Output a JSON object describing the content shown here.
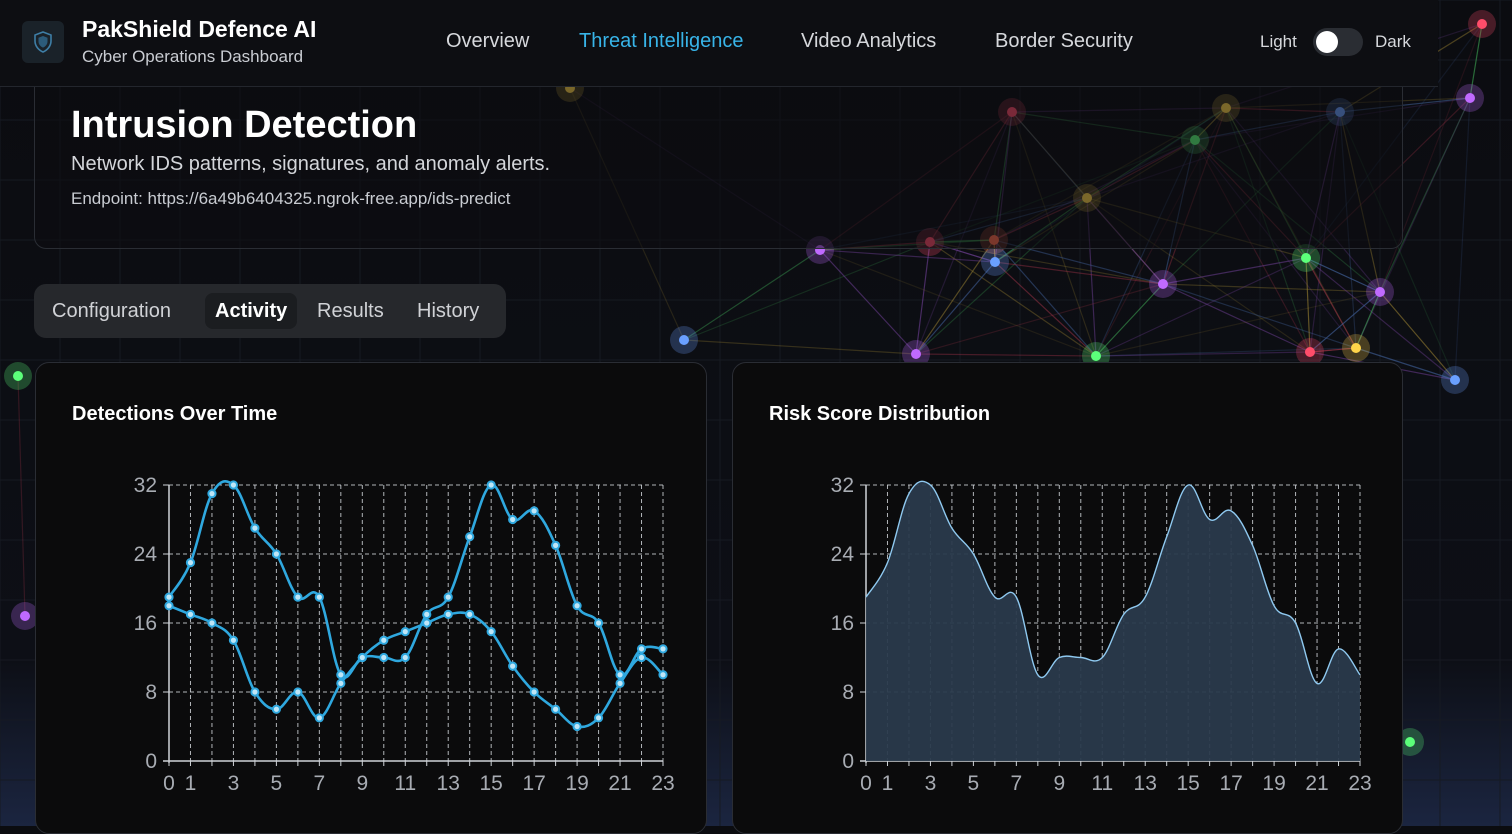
{
  "header": {
    "app_title": "PakShield Defence AI",
    "app_subtitle": "Cyber Operations Dashboard",
    "logo_icon": "shield-icon",
    "nav": [
      {
        "label": "Overview",
        "active": false
      },
      {
        "label": "Threat Intelligence",
        "active": true
      },
      {
        "label": "Video Analytics",
        "active": false
      },
      {
        "label": "Border Security",
        "active": false
      }
    ],
    "theme_toggle": {
      "light_label": "Light",
      "dark_label": "Dark",
      "state": "light"
    },
    "accent_color": "#38b4e8"
  },
  "page": {
    "title": "Intrusion Detection",
    "description": "Network IDS patterns, signatures, and anomaly alerts.",
    "endpoint": "Endpoint: https://6a49b6404325.ngrok-free.app/ids-predict"
  },
  "tabs": [
    {
      "label": "Configuration",
      "active": false
    },
    {
      "label": "Activity",
      "active": true
    },
    {
      "label": "Results",
      "active": false
    },
    {
      "label": "History",
      "active": false
    }
  ],
  "chart_data": [
    {
      "type": "line",
      "title": "Detections Over Time",
      "x": [
        0,
        1,
        2,
        3,
        4,
        5,
        6,
        7,
        8,
        9,
        10,
        11,
        12,
        13,
        14,
        15,
        16,
        17,
        18,
        19,
        20,
        21,
        22,
        23
      ],
      "x_ticks": [
        0,
        1,
        3,
        5,
        7,
        9,
        11,
        13,
        15,
        17,
        19,
        21,
        23
      ],
      "series": [
        {
          "values": [
            19,
            23,
            31,
            32,
            27,
            24,
            19,
            19,
            10,
            12,
            12,
            12,
            17,
            19,
            26,
            32,
            28,
            29,
            25,
            18,
            16,
            10,
            13,
            13
          ],
          "color": "#2fa8df"
        },
        {
          "values": [
            18,
            17,
            16,
            14,
            8,
            6,
            8,
            5,
            9,
            12,
            14,
            15,
            16,
            17,
            17,
            15,
            11,
            8,
            6,
            4,
            5,
            9,
            12,
            10
          ],
          "color": "#2fa8df"
        }
      ],
      "ylim": [
        0,
        32
      ],
      "y_ticks": [
        0,
        8,
        16,
        24,
        32
      ],
      "grid": true
    },
    {
      "type": "area",
      "title": "Risk Score Distribution",
      "x": [
        0,
        1,
        2,
        3,
        4,
        5,
        6,
        7,
        8,
        9,
        10,
        11,
        12,
        13,
        14,
        15,
        16,
        17,
        18,
        19,
        20,
        21,
        22,
        23
      ],
      "x_ticks": [
        0,
        1,
        3,
        5,
        7,
        9,
        11,
        13,
        15,
        17,
        19,
        21,
        23
      ],
      "values": [
        19,
        23,
        31,
        32,
        27,
        24,
        19,
        19,
        10,
        12,
        12,
        12,
        17,
        19,
        26,
        32,
        28,
        29,
        25,
        18,
        16,
        9,
        13,
        10
      ],
      "color": "#8fc9f0",
      "fill": "#2a3a4c",
      "ylim": [
        0,
        32
      ],
      "y_ticks": [
        0,
        8,
        16,
        24,
        32
      ],
      "grid": true
    }
  ]
}
